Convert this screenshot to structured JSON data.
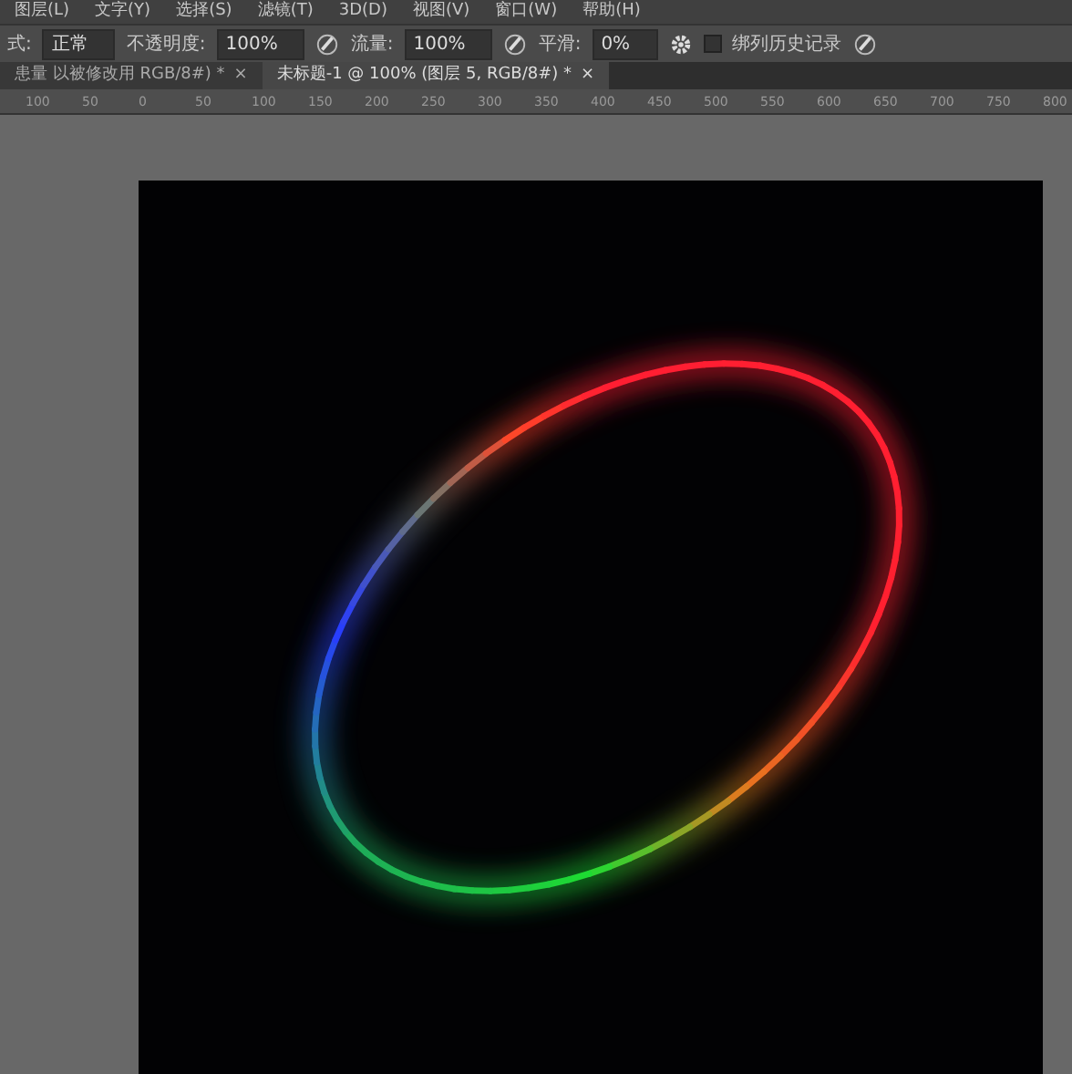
{
  "menu": [
    "图层(L)",
    "文字(Y)",
    "选择(S)",
    "滤镜(T)",
    "3D(D)",
    "视图(V)",
    "窗口(W)",
    "帮助(H)"
  ],
  "options": {
    "mode_label": "式:",
    "mode_value": "正常",
    "opacity_label": "不透明度:",
    "opacity_value": "100%",
    "flow_label": "流量:",
    "flow_value": "100%",
    "smoothing_label": "平滑:",
    "smoothing_value": "0%",
    "history": {
      "label": "绑列历史记录",
      "checked": false
    }
  },
  "tabs": [
    {
      "label": "患量 以被修改用 RGB/8#) *",
      "selected": false,
      "close": "×"
    },
    {
      "label": "未标题-1 @ 100% (图层 5, RGB/8#) *",
      "selected": true,
      "close": "×"
    }
  ],
  "ruler": [
    "100",
    "50",
    "0",
    "50",
    "100",
    "150",
    "200",
    "250",
    "300",
    "350",
    "400",
    "450",
    "500",
    "550",
    "600",
    "650",
    "700",
    "750",
    "800"
  ]
}
